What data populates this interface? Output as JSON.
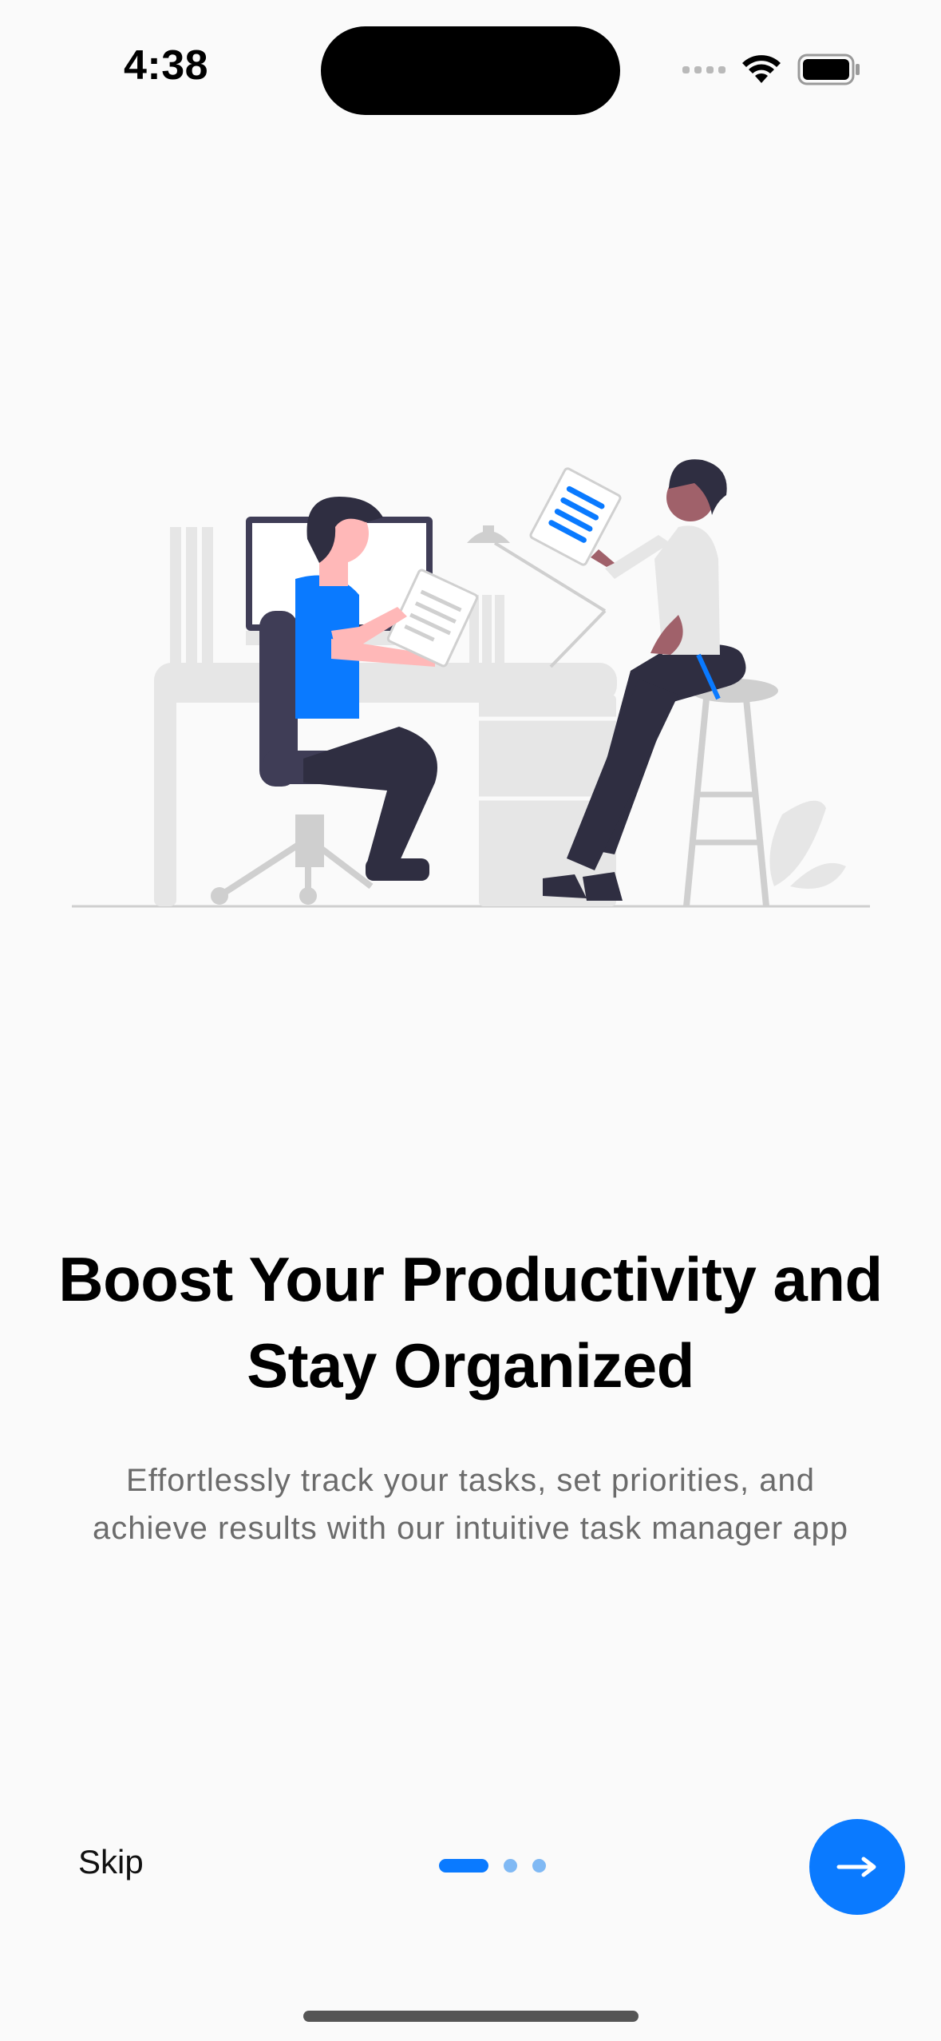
{
  "status_bar": {
    "time": "4:38",
    "icons": [
      "cellular-signal-icon",
      "wifi-icon",
      "battery-icon"
    ]
  },
  "illustration": {
    "name": "two-people-working-office-illustration",
    "accent_color": "#0a7aff"
  },
  "onboarding": {
    "title_line1": "Boost Your Productivity and",
    "title_line2": "Stay Organized",
    "subtitle_line1": "Effortlessly track your tasks, set priorities, and",
    "subtitle_line2": "achieve results with our intuitive task manager app"
  },
  "controls": {
    "skip_label": "Skip",
    "current_page": 1,
    "total_pages": 3,
    "next_icon": "arrow-right-icon"
  },
  "colors": {
    "background": "#fafafa",
    "primary": "#0a7aff",
    "inactive_dot": "#80b9f4",
    "subtitle_text": "#6b6b6b"
  }
}
